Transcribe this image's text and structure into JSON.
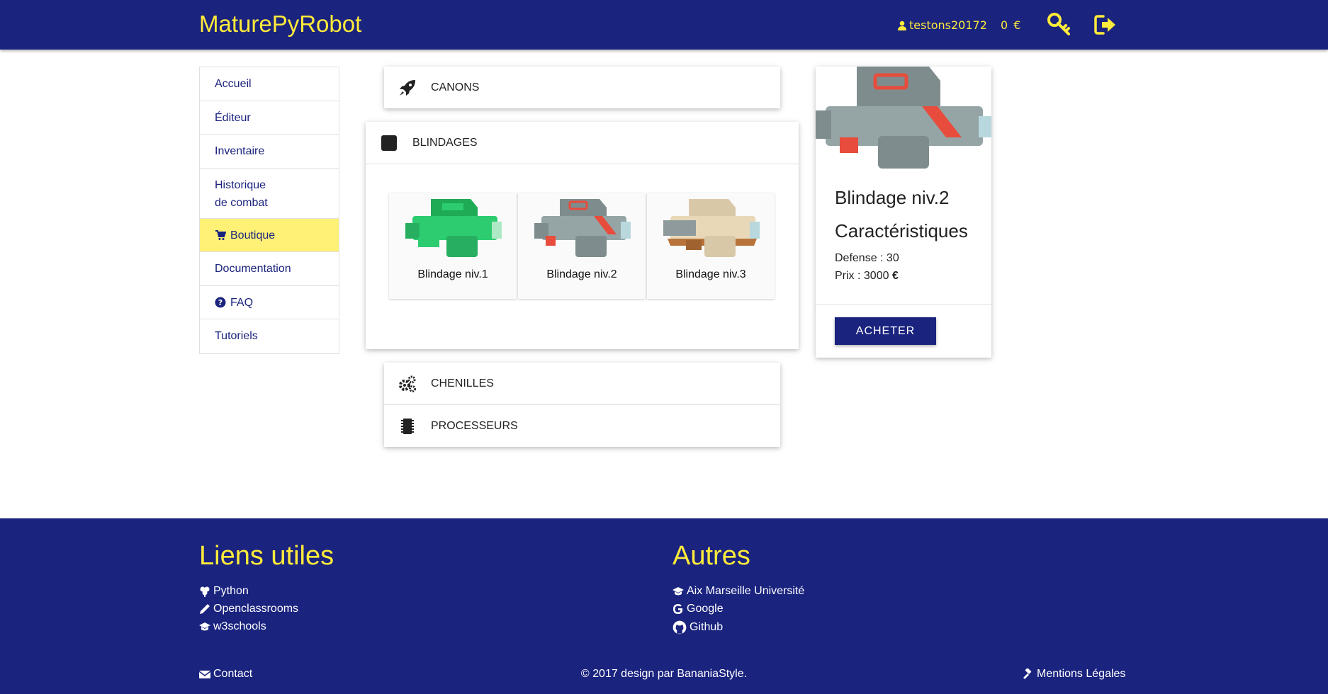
{
  "app": {
    "brand": "MaturePyRobot"
  },
  "header": {
    "username": "testons20172",
    "balance": "0",
    "currency": "€",
    "accent_color": "#ffeb3b",
    "bar_color": "#1a237e"
  },
  "sidebar": {
    "items": [
      {
        "label": "Accueil"
      },
      {
        "label": "Éditeur"
      },
      {
        "label": "Inventaire"
      },
      {
        "label_line1": "Historique",
        "label_line2": "de combat"
      },
      {
        "label": "Boutique",
        "active": true,
        "icon": "cart-icon"
      },
      {
        "label": "Documentation"
      },
      {
        "label": "FAQ",
        "icon": "question-circle-icon"
      },
      {
        "label": "Tutoriels"
      }
    ]
  },
  "shop": {
    "categories": [
      {
        "label": "CANONS",
        "icon": "rocket-icon"
      },
      {
        "label": "BLINDAGES",
        "icon": "square-icon",
        "expanded": true
      },
      {
        "label": "CHENILLES",
        "icon": "gears-icon"
      },
      {
        "label": "PROCESSEURS",
        "icon": "chip-icon"
      }
    ],
    "items": [
      {
        "label": "Blindage niv.1",
        "color": "#2ecc71"
      },
      {
        "label": "Blindage niv.2",
        "color": "#95a5a6"
      },
      {
        "label": "Blindage niv.3",
        "color": "#e8d8b8"
      }
    ]
  },
  "detail": {
    "title": "Blindage niv.2",
    "subtitle": "Caractéristiques",
    "defense": "Defense : 30",
    "price_label": "Prix : 3000",
    "price_currency": "€",
    "buy_label": "ACHETER"
  },
  "footer": {
    "col1_title": "Liens utiles",
    "col1_links": [
      "Python",
      "Openclassrooms",
      "w3schools"
    ],
    "col2_title": "Autres",
    "col2_links": [
      "Aix Marseille Université",
      "Google",
      "Github"
    ],
    "contact": "Contact",
    "copyright": "© 2017 design par BananiaStyle.",
    "legal": "Mentions Légales"
  }
}
